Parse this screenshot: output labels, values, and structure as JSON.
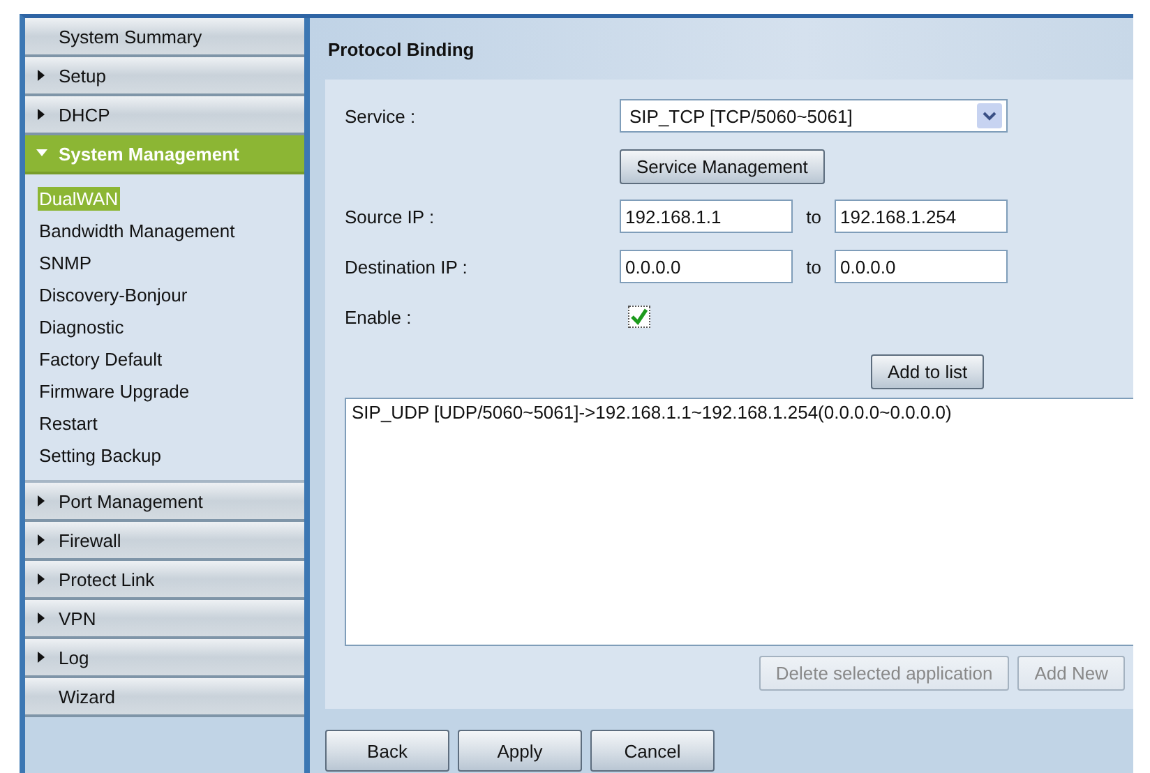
{
  "sidebar": {
    "items": [
      {
        "label": "System Summary",
        "kind": "plain"
      },
      {
        "label": "Setup",
        "kind": "group",
        "expanded": false
      },
      {
        "label": "DHCP",
        "kind": "group",
        "expanded": false
      },
      {
        "label": "System Management",
        "kind": "group",
        "expanded": true,
        "children": [
          {
            "label": "DualWAN",
            "selected": true
          },
          {
            "label": "Bandwidth Management",
            "selected": false
          },
          {
            "label": "SNMP",
            "selected": false
          },
          {
            "label": "Discovery-Bonjour",
            "selected": false
          },
          {
            "label": "Diagnostic",
            "selected": false
          },
          {
            "label": "Factory Default",
            "selected": false
          },
          {
            "label": "Firmware Upgrade",
            "selected": false
          },
          {
            "label": "Restart",
            "selected": false
          },
          {
            "label": "Setting Backup",
            "selected": false
          }
        ]
      },
      {
        "label": "Port Management",
        "kind": "group",
        "expanded": false
      },
      {
        "label": "Firewall",
        "kind": "group",
        "expanded": false
      },
      {
        "label": "Protect Link",
        "kind": "group",
        "expanded": false
      },
      {
        "label": "VPN",
        "kind": "group",
        "expanded": false
      },
      {
        "label": "Log",
        "kind": "group",
        "expanded": false
      },
      {
        "label": "Wizard",
        "kind": "plain"
      }
    ]
  },
  "page_title": "Protocol Binding",
  "form": {
    "service": {
      "label": "Service :",
      "value": "SIP_TCP [TCP/5060~5061]"
    },
    "service_management_button": "Service Management",
    "source_ip": {
      "label": "Source IP :",
      "from": "192.168.1.1",
      "separator": "to",
      "to": "192.168.1.254"
    },
    "destination_ip": {
      "label": "Destination IP :",
      "from": "0.0.0.0",
      "separator": "to",
      "to": "0.0.0.0"
    },
    "enable": {
      "label": "Enable :",
      "checked": true
    },
    "add_button": "Add to list"
  },
  "binding_list": [
    "SIP_UDP [UDP/5060~5061]->192.168.1.1~192.168.1.254(0.0.0.0~0.0.0.0)"
  ],
  "list_buttons": [
    {
      "label": "Delete selected application",
      "disabled": true
    },
    {
      "label": "Add New",
      "disabled": true
    }
  ],
  "footer_buttons": [
    "Back",
    "Apply",
    "Cancel"
  ]
}
